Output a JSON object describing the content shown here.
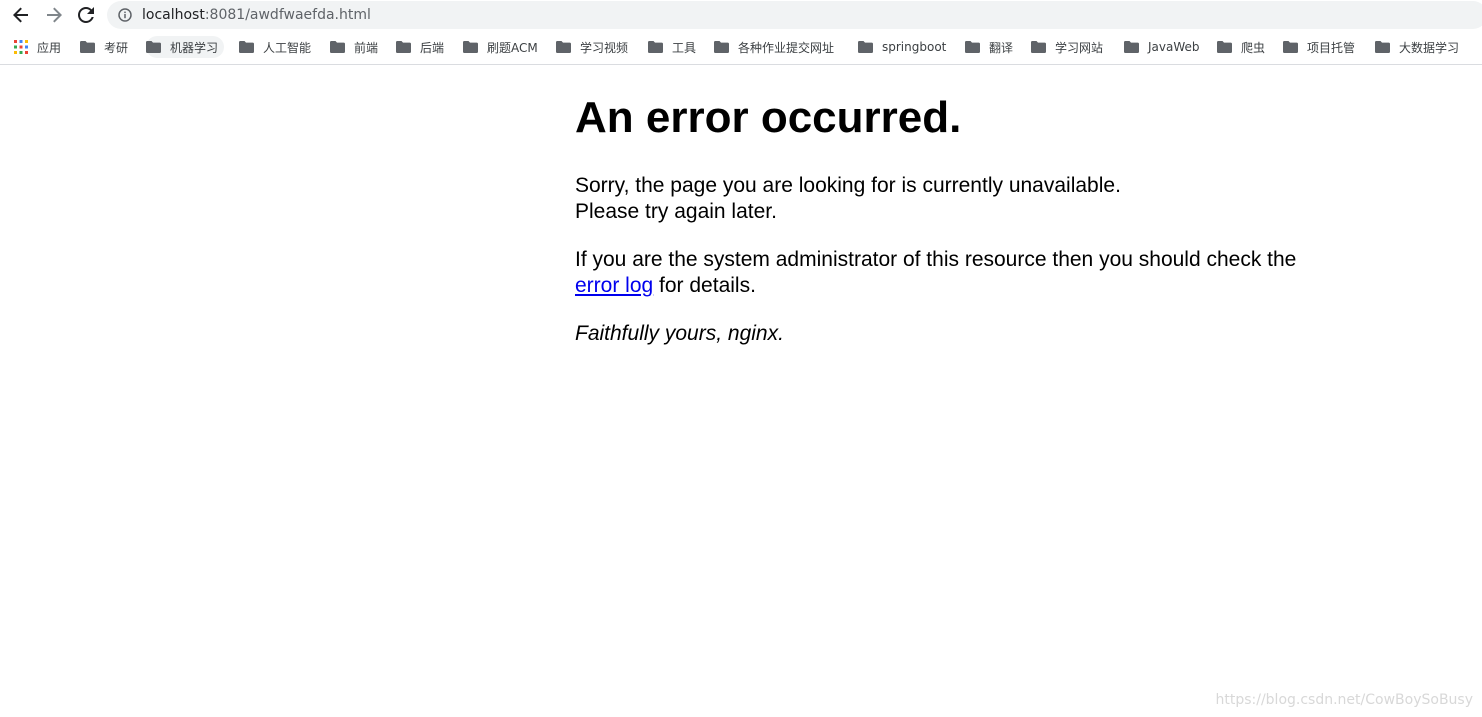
{
  "browser": {
    "url_host": "localhost",
    "url_rest": ":8081/awdfwaefda.html",
    "bookmarks": [
      "应用",
      "考研",
      "机器学习",
      "人工智能",
      "前端",
      "后端",
      "刷题ACM",
      "学习视频",
      "工具",
      "各种作业提交网址",
      "springboot",
      "翻译",
      "学习网站",
      "JavaWeb",
      "爬虫",
      "项目托管",
      "大数据学习"
    ]
  },
  "page": {
    "title": "An error occurred.",
    "line1": "Sorry, the page you are looking for is currently unavailable.",
    "line2": "Please try again later.",
    "admin_text": "If you are the system administrator of this resource then you should check the",
    "link_text": "error log",
    "after_link": " for details.",
    "signature": "Faithfully yours, nginx."
  },
  "watermark": "https://blog.csdn.net/CowBoySoBusy",
  "colors": {
    "link": "#0000ee",
    "omnibox_bg": "#f1f3f4",
    "folder_icon": "#5f6368"
  },
  "icons": [
    "back-arrow-icon",
    "forward-arrow-icon",
    "reload-icon",
    "info-icon",
    "apps-grid-icon",
    "folder-icon"
  ]
}
